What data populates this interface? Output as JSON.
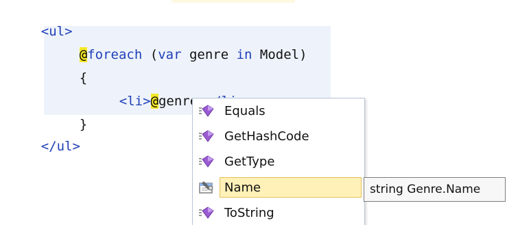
{
  "editor": {
    "lines": [
      {
        "tag_open": "<ul>"
      },
      {
        "at": "@",
        "kw": "foreach",
        "rest1": " (",
        "kw2": "var",
        "rest2": " genre ",
        "kw3": "in",
        "rest3": " Model)"
      },
      {
        "brace": "{"
      },
      {
        "tag1": "<li>",
        "at": "@",
        "text": "genre.",
        "tag2": "</li>"
      },
      {
        "brace": "}"
      },
      {
        "tag_close": "</ul>"
      }
    ]
  },
  "intellisense": {
    "items": [
      {
        "label": "Equals",
        "icon": "method-icon"
      },
      {
        "label": "GetHashCode",
        "icon": "method-icon"
      },
      {
        "label": "GetType",
        "icon": "method-icon"
      },
      {
        "label": "Name",
        "icon": "property-icon",
        "selected": true
      },
      {
        "label": "ToString",
        "icon": "method-icon"
      }
    ],
    "tooltip": "string Genre.Name"
  },
  "colors": {
    "keyword": "#1f3fb8",
    "razor_highlight": "#f5e72b",
    "selection": "#fff1b8",
    "method_icon": "#8a4fc4"
  }
}
